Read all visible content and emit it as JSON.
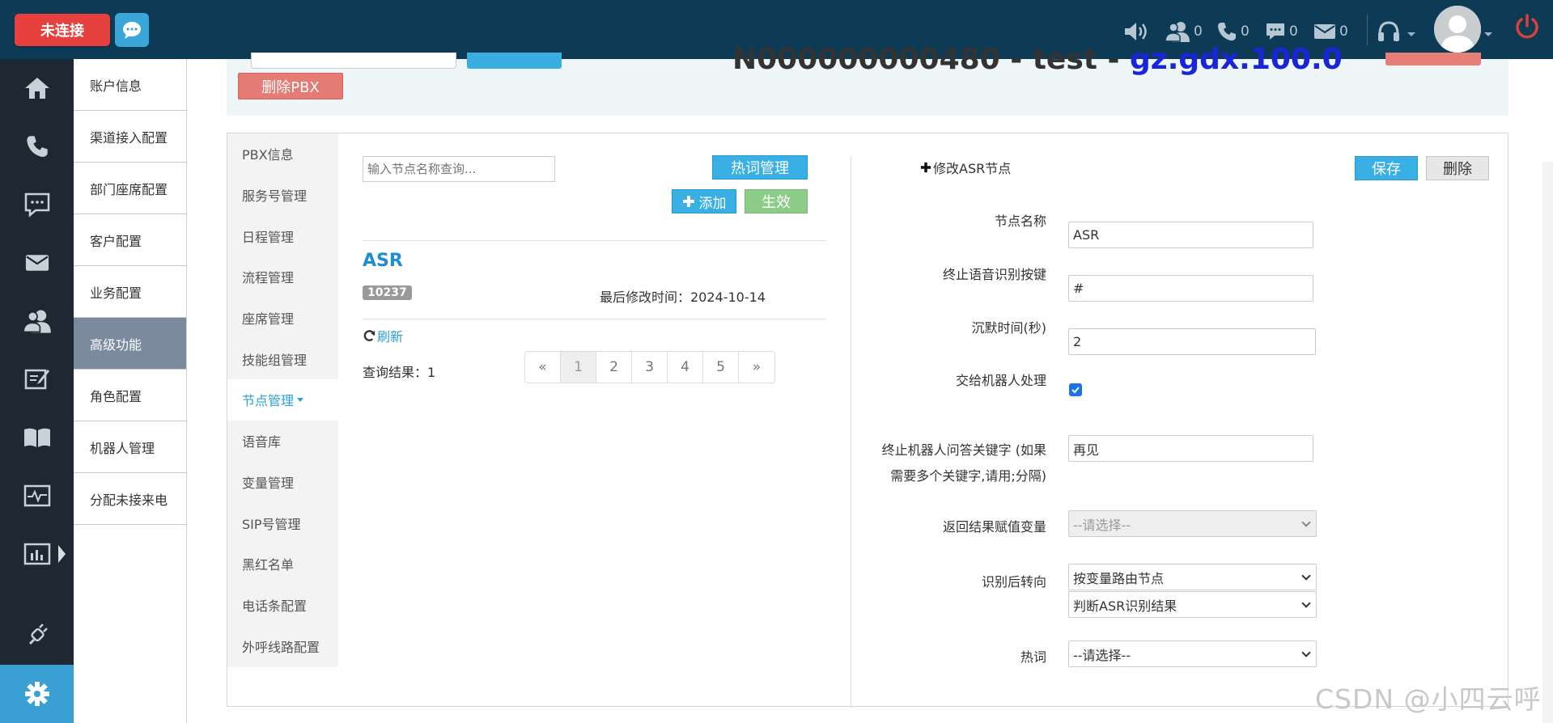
{
  "topbar": {
    "connection_status": "未连接",
    "counts": {
      "agents": "0",
      "calls": "0",
      "messages": "0",
      "mail": "0"
    }
  },
  "submenu": [
    "账户信息",
    "渠道接入配置",
    "部门座席配置",
    "客户配置",
    "业务配置",
    "高级功能",
    "角色配置",
    "机器人管理",
    "分配未接来电"
  ],
  "header": {
    "title_prefix": "N000000000480 - test - ",
    "title_suffix": "gz.gdx.100.0",
    "delete_pbx": "删除PBX"
  },
  "tabs": [
    "PBX信息",
    "服务号管理",
    "日程管理",
    "流程管理",
    "座席管理",
    "技能组管理",
    "节点管理",
    "语音库",
    "变量管理",
    "SIP号管理",
    "黑红名单",
    "电话条配置",
    "外呼线路配置"
  ],
  "node_list": {
    "search_placeholder": "输入节点名称查询...",
    "hot_words_btn": "热词管理",
    "add_btn": "添加",
    "effect_btn": "生效",
    "node_name": "ASR",
    "node_id": "10237",
    "last_modified": "最后修改时间：2024-10-14",
    "refresh": "刷新",
    "results": "查询结果：1",
    "pager": [
      "«",
      "1",
      "2",
      "3",
      "4",
      "5",
      "»"
    ]
  },
  "edit_form": {
    "title": "修改ASR节点",
    "save_btn": "保存",
    "delete_btn": "删除",
    "labels": {
      "node_name": "节点名称",
      "stop_key": "终止语音识别按键",
      "silence": "沉默时间(秒)",
      "to_robot": "交给机器人处理",
      "stop_keywords_1": "终止机器人问答关键字 (如果",
      "stop_keywords_2": "需要多个关键字,请用;分隔)",
      "result_var": "返回结果赋值变量",
      "after_recog": "识别后转向",
      "hot_words": "热词"
    },
    "values": {
      "node_name": "ASR",
      "stop_key": "#",
      "silence": "2",
      "to_robot_checked": true,
      "stop_keywords": "再见",
      "result_var": "--请选择--",
      "after_recog_1": "按变量路由节点",
      "after_recog_2": "判断ASR识别结果",
      "hot_words": "--请选择--"
    }
  },
  "watermark": "CSDN @小四云呼"
}
